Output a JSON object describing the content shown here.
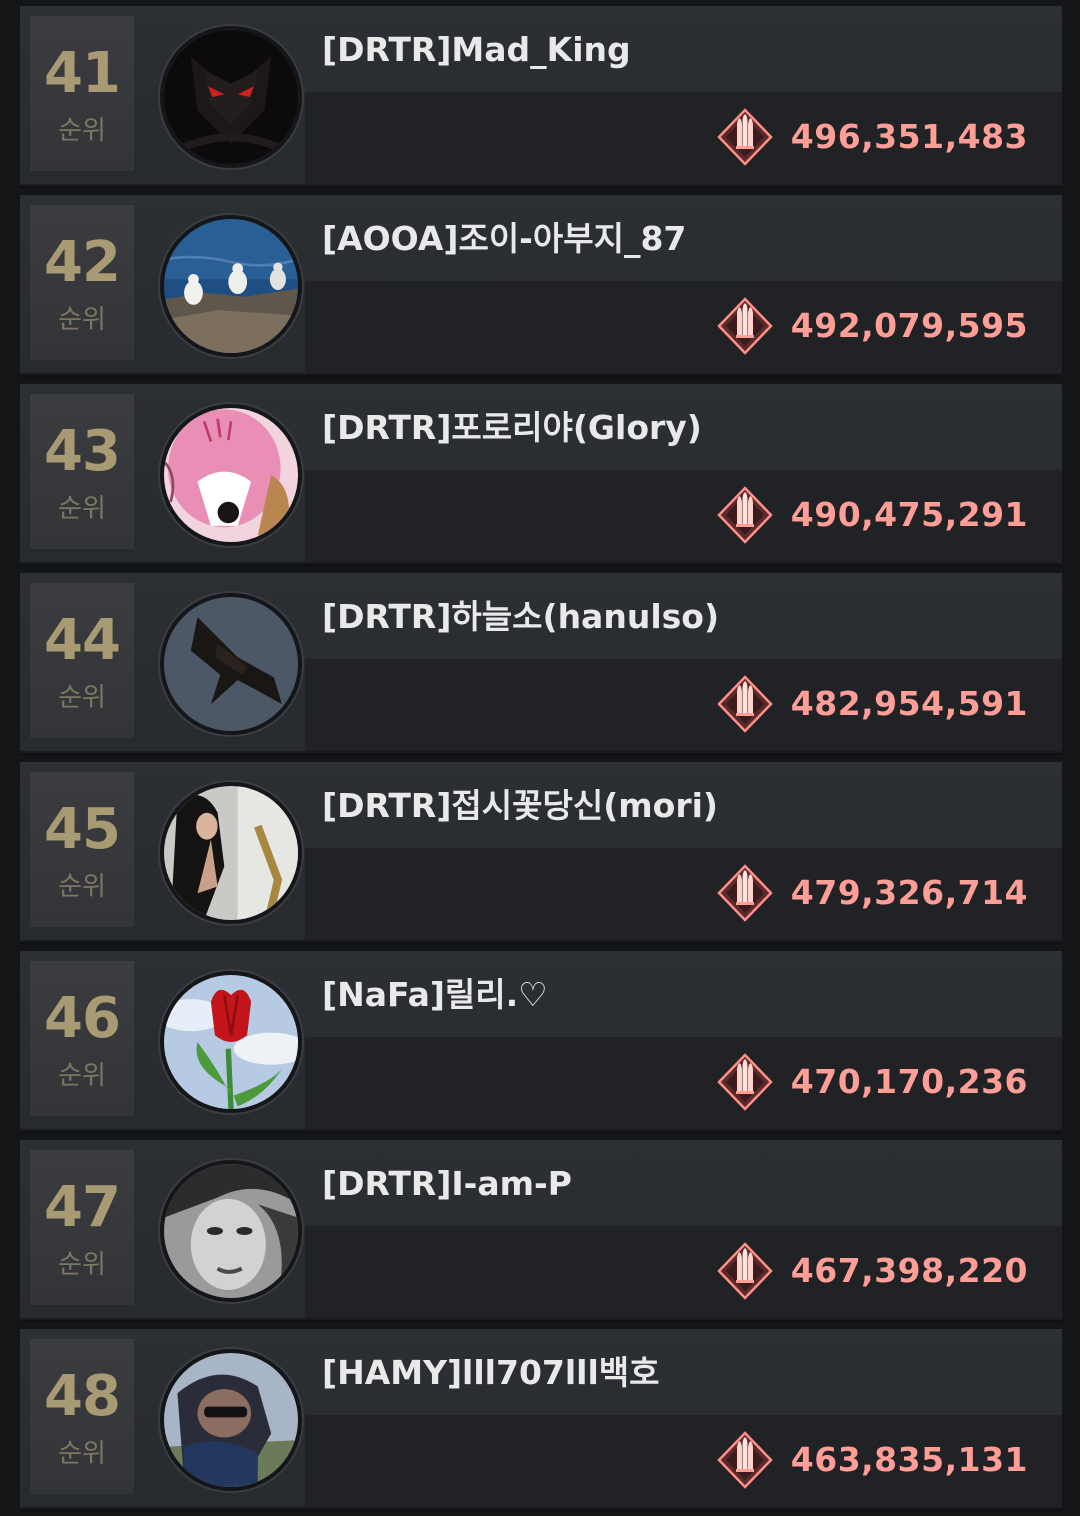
{
  "ranking": {
    "rank_suffix": "순위",
    "rows": [
      {
        "rank": "41",
        "name": "[DRTR]Mad_King",
        "score": "496,351,483",
        "avatar": "dark-red-eyes-creature"
      },
      {
        "rank": "42",
        "name": "[AOOA]조이-아부지_87",
        "score": "492,079,595",
        "avatar": "seagulls-on-rocks"
      },
      {
        "rank": "43",
        "name": "[DRTR]포로리야(Glory)",
        "score": "490,475,291",
        "avatar": "pink-cartoon-character"
      },
      {
        "rank": "44",
        "name": "[DRTR]하늘소(hanulso)",
        "score": "482,954,591",
        "avatar": "eagle-in-sky"
      },
      {
        "rank": "45",
        "name": "[DRTR]접시꽃당신(mori)",
        "score": "479,326,714",
        "avatar": "woman-with-saxophone"
      },
      {
        "rank": "46",
        "name": "[NaFa]릴리.♡",
        "score": "470,170,236",
        "avatar": "red-tulip"
      },
      {
        "rank": "47",
        "name": "[DRTR]I-am-P",
        "score": "467,398,220",
        "avatar": "bw-portrait-face"
      },
      {
        "rank": "48",
        "name": "[HAMY]lll707lll백호",
        "score": "463,835,131",
        "avatar": "man-with-sunglasses"
      }
    ]
  },
  "score_icon": "ammo-bullets-icon",
  "colors": {
    "rank_gold": "#a89a72",
    "score_pink": "#ff9e96",
    "name_white": "#e9e9ea",
    "row_bg": "#2c2f34"
  }
}
